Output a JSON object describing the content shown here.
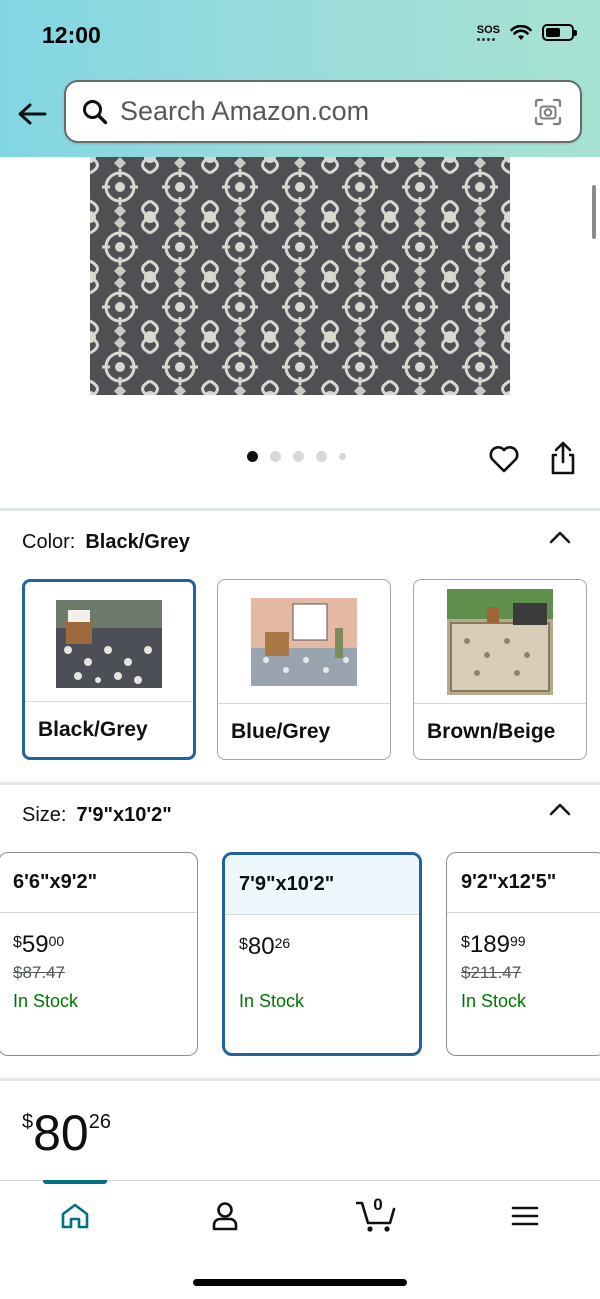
{
  "status_bar": {
    "time": "12:00",
    "sos": "SOS"
  },
  "search": {
    "placeholder": "Search Amazon.com"
  },
  "gallery": {
    "image_count": 5,
    "active_index": 0
  },
  "color": {
    "label": "Color:",
    "selected": "Black/Grey",
    "options": [
      {
        "name": "Black/Grey"
      },
      {
        "name": "Blue/Grey"
      },
      {
        "name": "Brown/Beige"
      }
    ]
  },
  "size": {
    "label": "Size:",
    "selected": "7'9\"x10'2\"",
    "options": [
      {
        "name": "6'6\"x9'2\"",
        "currency": "$",
        "whole": "59",
        "fraction": "00",
        "list_price": "$87.47",
        "stock": "In Stock"
      },
      {
        "name": "7'9\"x10'2\"",
        "currency": "$",
        "whole": "80",
        "fraction": "26",
        "list_price": "",
        "stock": "In Stock"
      },
      {
        "name": "9'2\"x12'5\"",
        "currency": "$",
        "whole": "189",
        "fraction": "99",
        "list_price": "$211.47",
        "stock": "In Stock"
      }
    ]
  },
  "price": {
    "currency": "$",
    "whole": "80",
    "fraction": "26"
  },
  "cart": {
    "count": "0"
  },
  "colors": {
    "accent": "#2162a1",
    "in_stock": "#007600",
    "nav_active": "#007185"
  },
  "icons": [
    "back-arrow-icon",
    "search-icon",
    "camera-icon",
    "heart-icon",
    "share-icon",
    "chevron-up-icon",
    "home-icon",
    "account-icon",
    "cart-icon",
    "menu-icon"
  ]
}
